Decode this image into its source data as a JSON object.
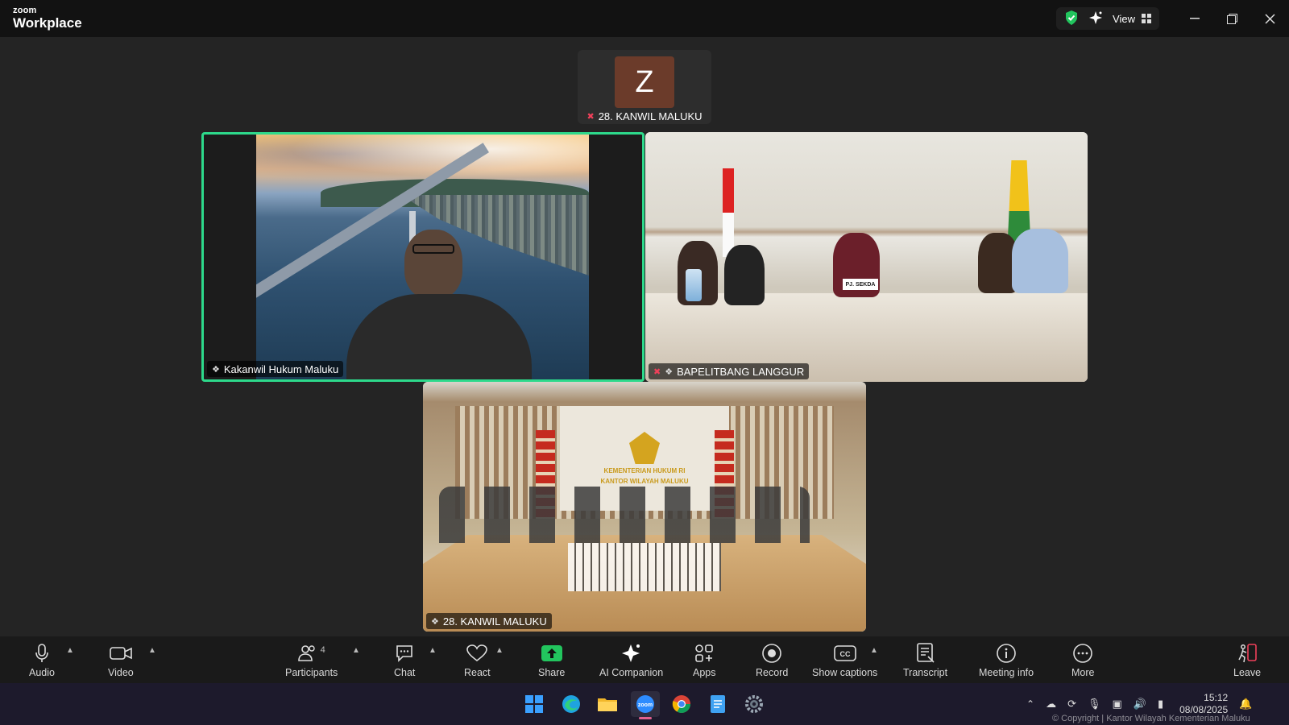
{
  "titlebar": {
    "brand_small": "zoom",
    "brand_big": "Workplace",
    "view_label": "View"
  },
  "tiles": {
    "top": {
      "initial": "Z",
      "name": "28. KANWIL MALUKU"
    },
    "left": {
      "name": "Kakanwil Hukum Maluku"
    },
    "right": {
      "name": "BAPELITBANG LANGGUR",
      "nameplate": "PJ. SEKDA"
    },
    "bottom": {
      "name": "28. KANWIL MALUKU",
      "wall_text_1": "KEMENTERIAN HUKUM RI",
      "wall_text_2": "KANTOR WILAYAH MALUKU"
    }
  },
  "toolbar": {
    "audio": "Audio",
    "video": "Video",
    "participants": "Participants",
    "participants_count": "4",
    "chat": "Chat",
    "react": "React",
    "share": "Share",
    "ai_companion": "AI Companion",
    "apps": "Apps",
    "record": "Record",
    "show_captions": "Show captions",
    "transcript": "Transcript",
    "meeting_info": "Meeting info",
    "more": "More",
    "leave": "Leave"
  },
  "taskbar": {
    "time": "15:12",
    "date": "08/08/2025",
    "copyright": "© Copyright | Kantor Wilayah Kementerian Maluku"
  },
  "colors": {
    "active_speaker": "#2dd98b",
    "avatar_bg": "#6b3b2a",
    "share_green": "#22c55e",
    "mic_off_red": "#f0405a"
  }
}
